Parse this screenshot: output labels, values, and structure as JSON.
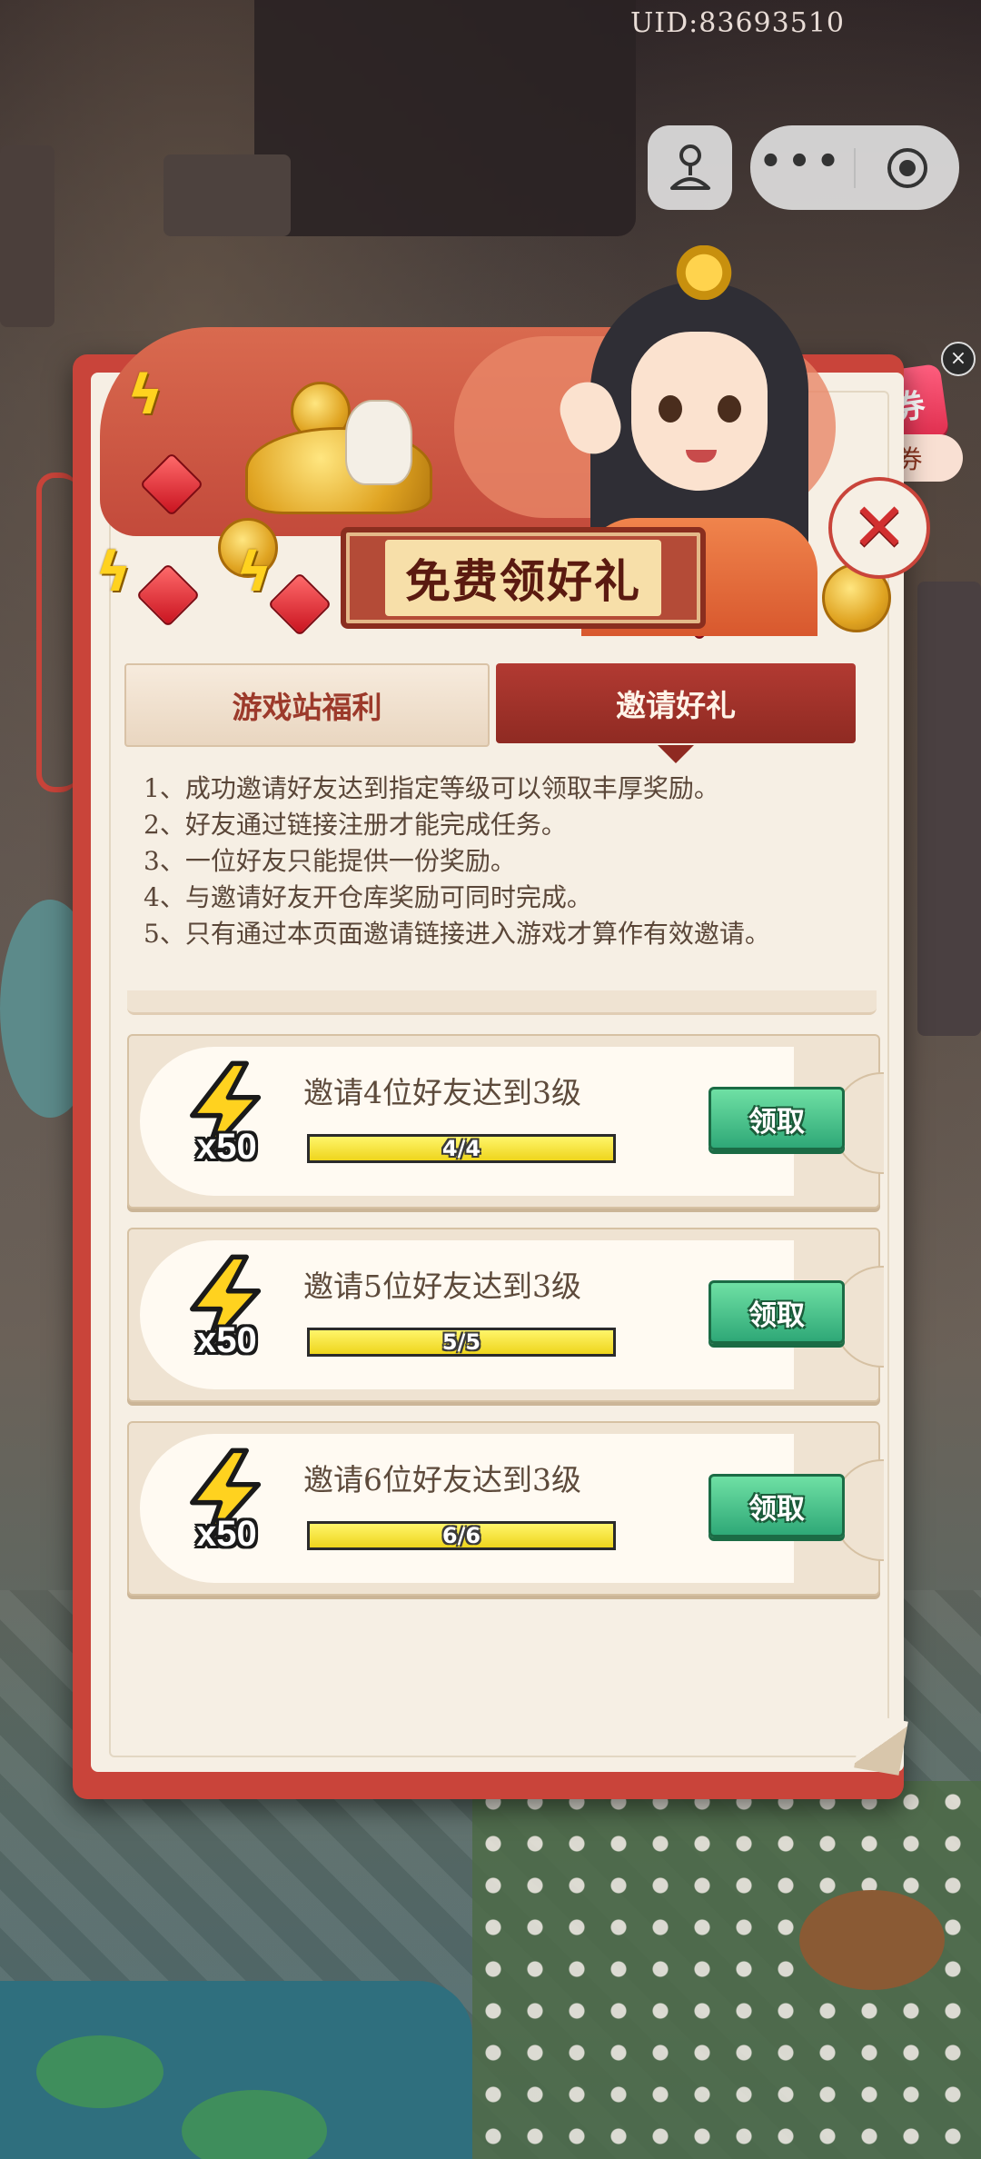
{
  "top_bar": {
    "uid": "UID:83693510"
  },
  "side": {
    "coupon_glyph": "券",
    "coupon_label": "领券",
    "close_glyph": "×"
  },
  "modal": {
    "title": "免费领好礼",
    "close_glyph": "✕",
    "tabs": [
      {
        "label": "游戏站福利",
        "active": false
      },
      {
        "label": "邀请好礼",
        "active": true
      }
    ],
    "rules": [
      "1、成功邀请好友达到指定等级可以领取丰厚奖励。",
      "2、好友通过链接注册才能完成任务。",
      "3、一位好友只能提供一份奖励。",
      "4、与邀请好友开仓库奖励可同时完成。",
      "5、只有通过本页面邀请链接进入游戏才算作有效邀请。"
    ],
    "tasks": [
      {
        "title": "邀请4位好友达到3级",
        "reward": "x50",
        "progress_text": "4/4",
        "progress": 1.0,
        "button": "领取"
      },
      {
        "title": "邀请5位好友达到3级",
        "reward": "x50",
        "progress_text": "5/5",
        "progress": 1.0,
        "button": "领取"
      },
      {
        "title": "邀请6位好友达到3级",
        "reward": "x50",
        "progress_text": "6/6",
        "progress": 1.0,
        "button": "领取"
      }
    ]
  },
  "colors": {
    "frame": "#c9443a",
    "paper": "#f6efe4",
    "claim_green": "#2fa877",
    "bar_yellow": "#fbee3a",
    "active_tab": "#8f2a22"
  },
  "icons": [
    "person-joystick-icon",
    "more-dots-icon",
    "record-target-icon",
    "close-icon",
    "lightning-energy-icon",
    "coupon-icon"
  ]
}
